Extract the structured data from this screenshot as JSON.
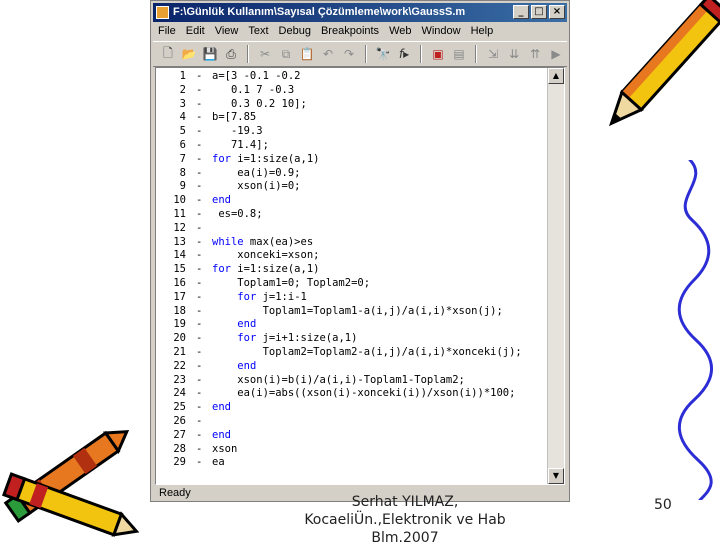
{
  "window": {
    "title": "F:\\Günlük Kullanım\\Sayısal Çözümleme\\work\\GaussS.m",
    "minimize": "_",
    "maximize": "□",
    "close": "×"
  },
  "menu": [
    "File",
    "Edit",
    "View",
    "Text",
    "Debug",
    "Breakpoints",
    "Web",
    "Window",
    "Help"
  ],
  "toolbar": {
    "icons": [
      "new-file-icon",
      "open-folder-icon",
      "save-icon",
      "print-icon",
      "cut-icon",
      "copy-icon",
      "paste-icon",
      "undo-icon",
      "redo-icon",
      "find-icon",
      "function-icon",
      "set-breakpoint-icon",
      "clear-breakpoint-icon",
      "step-icon",
      "step-in-icon",
      "step-out-icon",
      "continue-icon"
    ]
  },
  "code": [
    {
      "n": "1",
      "text": "a=[3 -0.1 -0.2"
    },
    {
      "n": "2",
      "text": "   0.1 7 -0.3"
    },
    {
      "n": "3",
      "text": "   0.3 0.2 10];"
    },
    {
      "n": "4",
      "text": "b=[7.85"
    },
    {
      "n": "5",
      "text": "   -19.3"
    },
    {
      "n": "6",
      "text": "   71.4];"
    },
    {
      "n": "7",
      "text": "for i=1:size(a,1)",
      "kw": "for"
    },
    {
      "n": "8",
      "text": "    ea(i)=0.9;"
    },
    {
      "n": "9",
      "text": "    xson(i)=0;"
    },
    {
      "n": "10",
      "text": "end",
      "kw": "end"
    },
    {
      "n": "11",
      "text": " es=0.8;"
    },
    {
      "n": "12",
      "text": ""
    },
    {
      "n": "13",
      "text": "while max(ea)>es",
      "kw": "while"
    },
    {
      "n": "14",
      "text": "    xonceki=xson;"
    },
    {
      "n": "15",
      "text": "for i=1:size(a,1)",
      "kw": "for"
    },
    {
      "n": "16",
      "text": "    Toplam1=0; Toplam2=0;"
    },
    {
      "n": "17",
      "text": "    for j=1:i-1",
      "kw": "for"
    },
    {
      "n": "18",
      "text": "        Toplam1=Toplam1-a(i,j)/a(i,i)*xson(j);"
    },
    {
      "n": "19",
      "text": "    end",
      "kw": "end"
    },
    {
      "n": "20",
      "text": "    for j=i+1:size(a,1)",
      "kw": "for"
    },
    {
      "n": "21",
      "text": "        Toplam2=Toplam2-a(i,j)/a(i,i)*xonceki(j);"
    },
    {
      "n": "22",
      "text": "    end",
      "kw": "end"
    },
    {
      "n": "23",
      "text": "    xson(i)=b(i)/a(i,i)-Toplam1-Toplam2;"
    },
    {
      "n": "24",
      "text": "    ea(i)=abs((xson(i)-xonceki(i))/xson(i))*100;"
    },
    {
      "n": "25",
      "text": "end",
      "kw": "end"
    },
    {
      "n": "26",
      "text": ""
    },
    {
      "n": "27",
      "text": "end",
      "kw": "end"
    },
    {
      "n": "28",
      "text": "xson"
    },
    {
      "n": "29",
      "text": "ea"
    }
  ],
  "status": "Ready",
  "footer": {
    "line1": "Serhat YILMAZ,",
    "line2": "KocaeliÜn.,Elektronik ve Hab",
    "line3": "Blm.2007"
  },
  "page_number": "50",
  "colors": {
    "keyword": "#0000ff",
    "title_bar": "#0a246a",
    "pencil_yellow": "#f2c40f",
    "pencil_orange": "#e8781f",
    "squiggle": "#2d2dd6"
  }
}
